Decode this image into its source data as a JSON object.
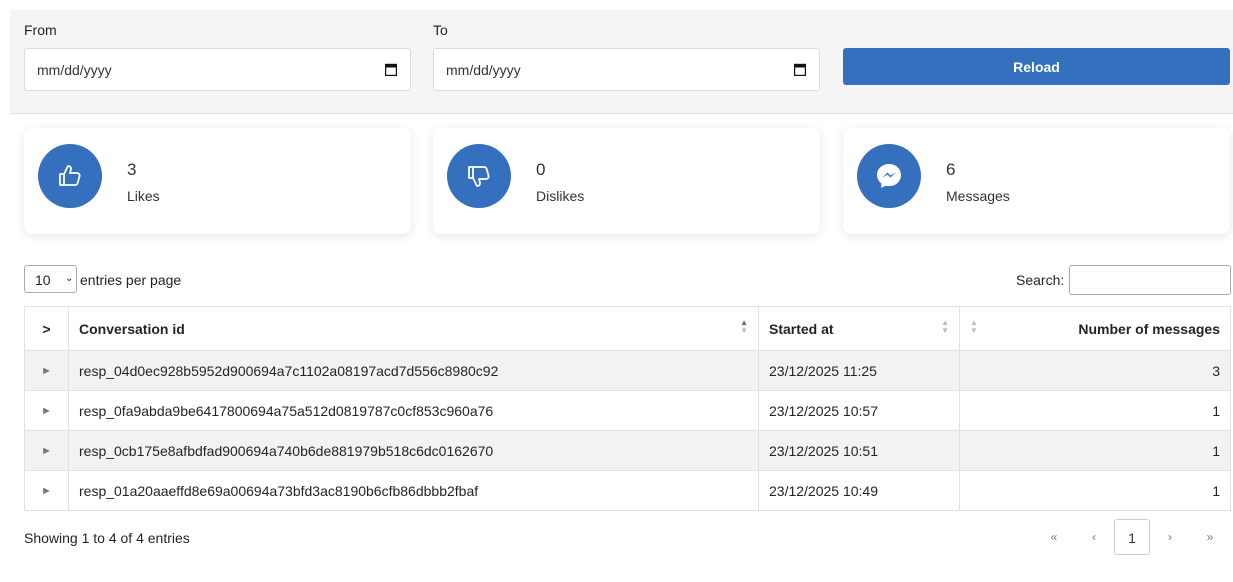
{
  "filters": {
    "from_label": "From",
    "to_label": "To",
    "from_value": "mm/dd/yyyy",
    "to_value": "mm/dd/yyyy",
    "reload_label": "Reload"
  },
  "cards": [
    {
      "value": "3",
      "label": "Likes",
      "icon": "thumbs-up-icon"
    },
    {
      "value": "0",
      "label": "Dislikes",
      "icon": "thumbs-down-icon"
    },
    {
      "value": "6",
      "label": "Messages",
      "icon": "messenger-icon"
    }
  ],
  "table_controls": {
    "page_length": "10",
    "page_length_text": "entries per page",
    "search_label": "Search:"
  },
  "table": {
    "headers": [
      ">",
      "Conversation id",
      "Started at",
      "Number of messages"
    ],
    "rows": [
      {
        "toggle": "►",
        "id": "resp_04d0ec928b5952d900694a7c1102a08197acd7d556c8980c92",
        "started": "23/12/2025 11:25",
        "count": "3"
      },
      {
        "toggle": "►",
        "id": "resp_0fa9abda9be6417800694a75a512d0819787c0cf853c960a76",
        "started": "23/12/2025 10:57",
        "count": "1"
      },
      {
        "toggle": "►",
        "id": "resp_0cb175e8afbdfad900694a740b6de881979b518c6dc0162670",
        "started": "23/12/2025 10:51",
        "count": "1"
      },
      {
        "toggle": "►",
        "id": "resp_01a20aaeffd8e69a00694a73bfd3ac8190b6cfb86dbbb2fbaf",
        "started": "23/12/2025 10:49",
        "count": "1"
      }
    ]
  },
  "footer": {
    "info": "Showing 1 to 4 of 4 entries",
    "first": "«",
    "prev": "‹",
    "current": "1",
    "next": "›",
    "last": "»"
  },
  "colors": {
    "accent": "#3470bd"
  }
}
